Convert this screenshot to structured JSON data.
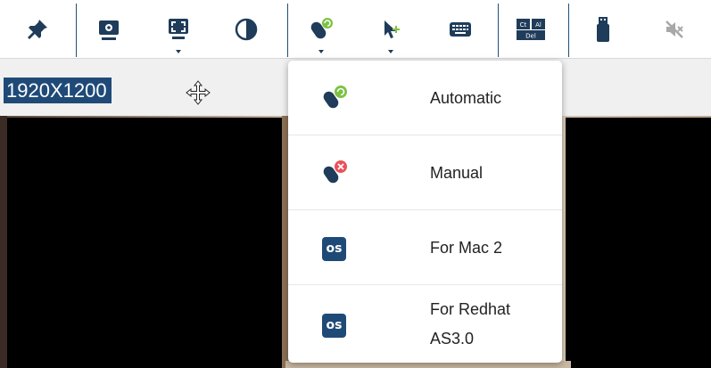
{
  "resolution": "1920X1200",
  "toolbar": {
    "buttons": [
      {
        "icon": "pin-icon"
      },
      {
        "icon": "screen-settings-icon"
      },
      {
        "icon": "fullscreen-icon"
      },
      {
        "icon": "contrast-icon"
      },
      {
        "icon": "mouse-sync-icon"
      },
      {
        "icon": "pointer-icon"
      },
      {
        "icon": "keyboard-icon"
      },
      {
        "icon": "ctrl-alt-del-icon",
        "labels": [
          "Ct",
          "Al",
          "Del"
        ]
      },
      {
        "icon": "usb-icon"
      },
      {
        "icon": "speaker-muted-icon"
      }
    ]
  },
  "mouse_sync_menu": {
    "items": [
      {
        "label": "Automatic",
        "icon": "mouse-auto-icon"
      },
      {
        "label": "Manual",
        "icon": "mouse-manual-icon"
      },
      {
        "label": "For Mac 2",
        "icon": "os-badge-icon",
        "badge": "os"
      },
      {
        "label": "For Redhat AS3.0",
        "icon": "os-badge-icon",
        "badge": "os"
      }
    ]
  },
  "colors": {
    "accent": "#1f4a78",
    "green_badge": "#7cc242",
    "red_badge": "#e8525a"
  }
}
